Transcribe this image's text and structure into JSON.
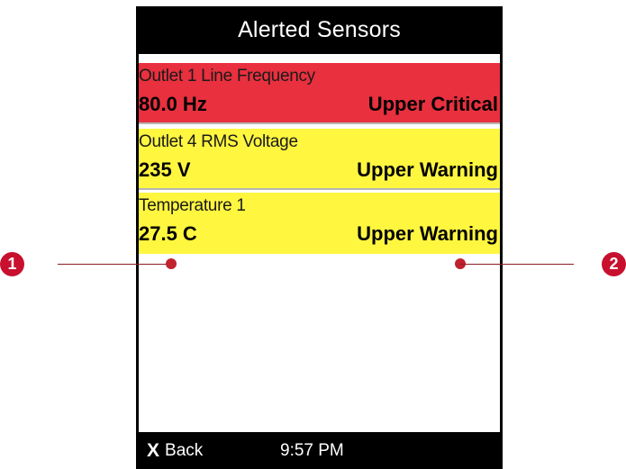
{
  "screen": {
    "title": "Alerted Sensors"
  },
  "sensors": [
    {
      "name": "Outlet 1 Line Frequency",
      "value": "80.0 Hz",
      "state": "Upper Critical",
      "color": "#e8303e"
    },
    {
      "name": "Outlet 4 RMS Voltage",
      "value": "235 V",
      "state": "Upper Warning",
      "color": "#fff640"
    },
    {
      "name": "Temperature 1",
      "value": "27.5 C",
      "state": "Upper Warning",
      "color": "#fff640"
    }
  ],
  "footer": {
    "back_icon": "X",
    "back_label": "Back",
    "time": "9:57 PM"
  },
  "callouts": [
    {
      "number": "1"
    },
    {
      "number": "2"
    }
  ],
  "colors": {
    "frame": "#000000",
    "critical": "#e8303e",
    "warning": "#fff640",
    "callout": "#c8102e"
  }
}
